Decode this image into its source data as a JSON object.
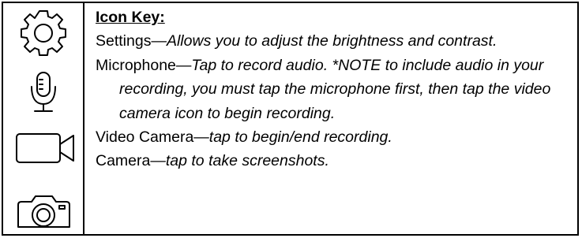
{
  "icon_key": {
    "title": "Icon Key:",
    "entries": [
      {
        "icon": "gear-icon",
        "name": "Settings",
        "sep": "—",
        "desc": "Allows you to adjust the brightness and contrast."
      },
      {
        "icon": "microphone-icon",
        "name": "Microphone",
        "sep": "—",
        "desc": "Tap to record audio. *NOTE to include audio in your recording, you must tap the microphone first, then tap the video camera icon to begin recording."
      },
      {
        "icon": "video-camera-icon",
        "name": "Video Camera",
        "sep": "—",
        "desc": "tap to begin/end recording."
      },
      {
        "icon": "camera-icon",
        "name": "Camera",
        "sep": "—",
        "desc": "tap to take screenshots."
      }
    ]
  }
}
